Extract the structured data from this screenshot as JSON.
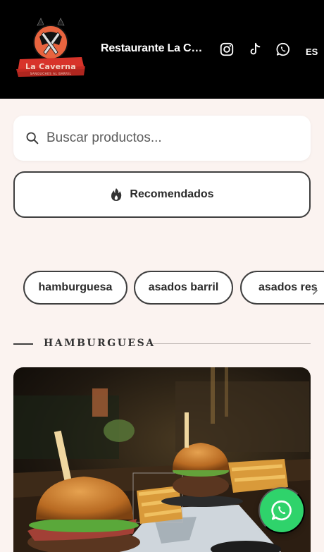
{
  "header": {
    "logo": {
      "name": "La Caverna",
      "tagline": "SANGUCHES AL BARRIL"
    },
    "title": "Restaurante La Caverna",
    "social": [
      {
        "icon": "instagram-icon"
      },
      {
        "icon": "tiktok-icon"
      },
      {
        "icon": "whatsapp-icon"
      }
    ],
    "language": "ES"
  },
  "search": {
    "placeholder": "Buscar productos...",
    "value": ""
  },
  "recommended": {
    "icon": "fire-icon",
    "label": "Recomendados"
  },
  "categories": [
    {
      "label": "hamburguesa"
    },
    {
      "label": "asados barril"
    },
    {
      "label": "asados res"
    }
  ],
  "section": {
    "title": "HAMBURGUESA"
  },
  "colors": {
    "header_bg": "#000000",
    "page_bg": "#fbf3f0",
    "border": "#3f3f3f",
    "whatsapp": "#2fd36b",
    "logo_red": "#d8342a"
  }
}
